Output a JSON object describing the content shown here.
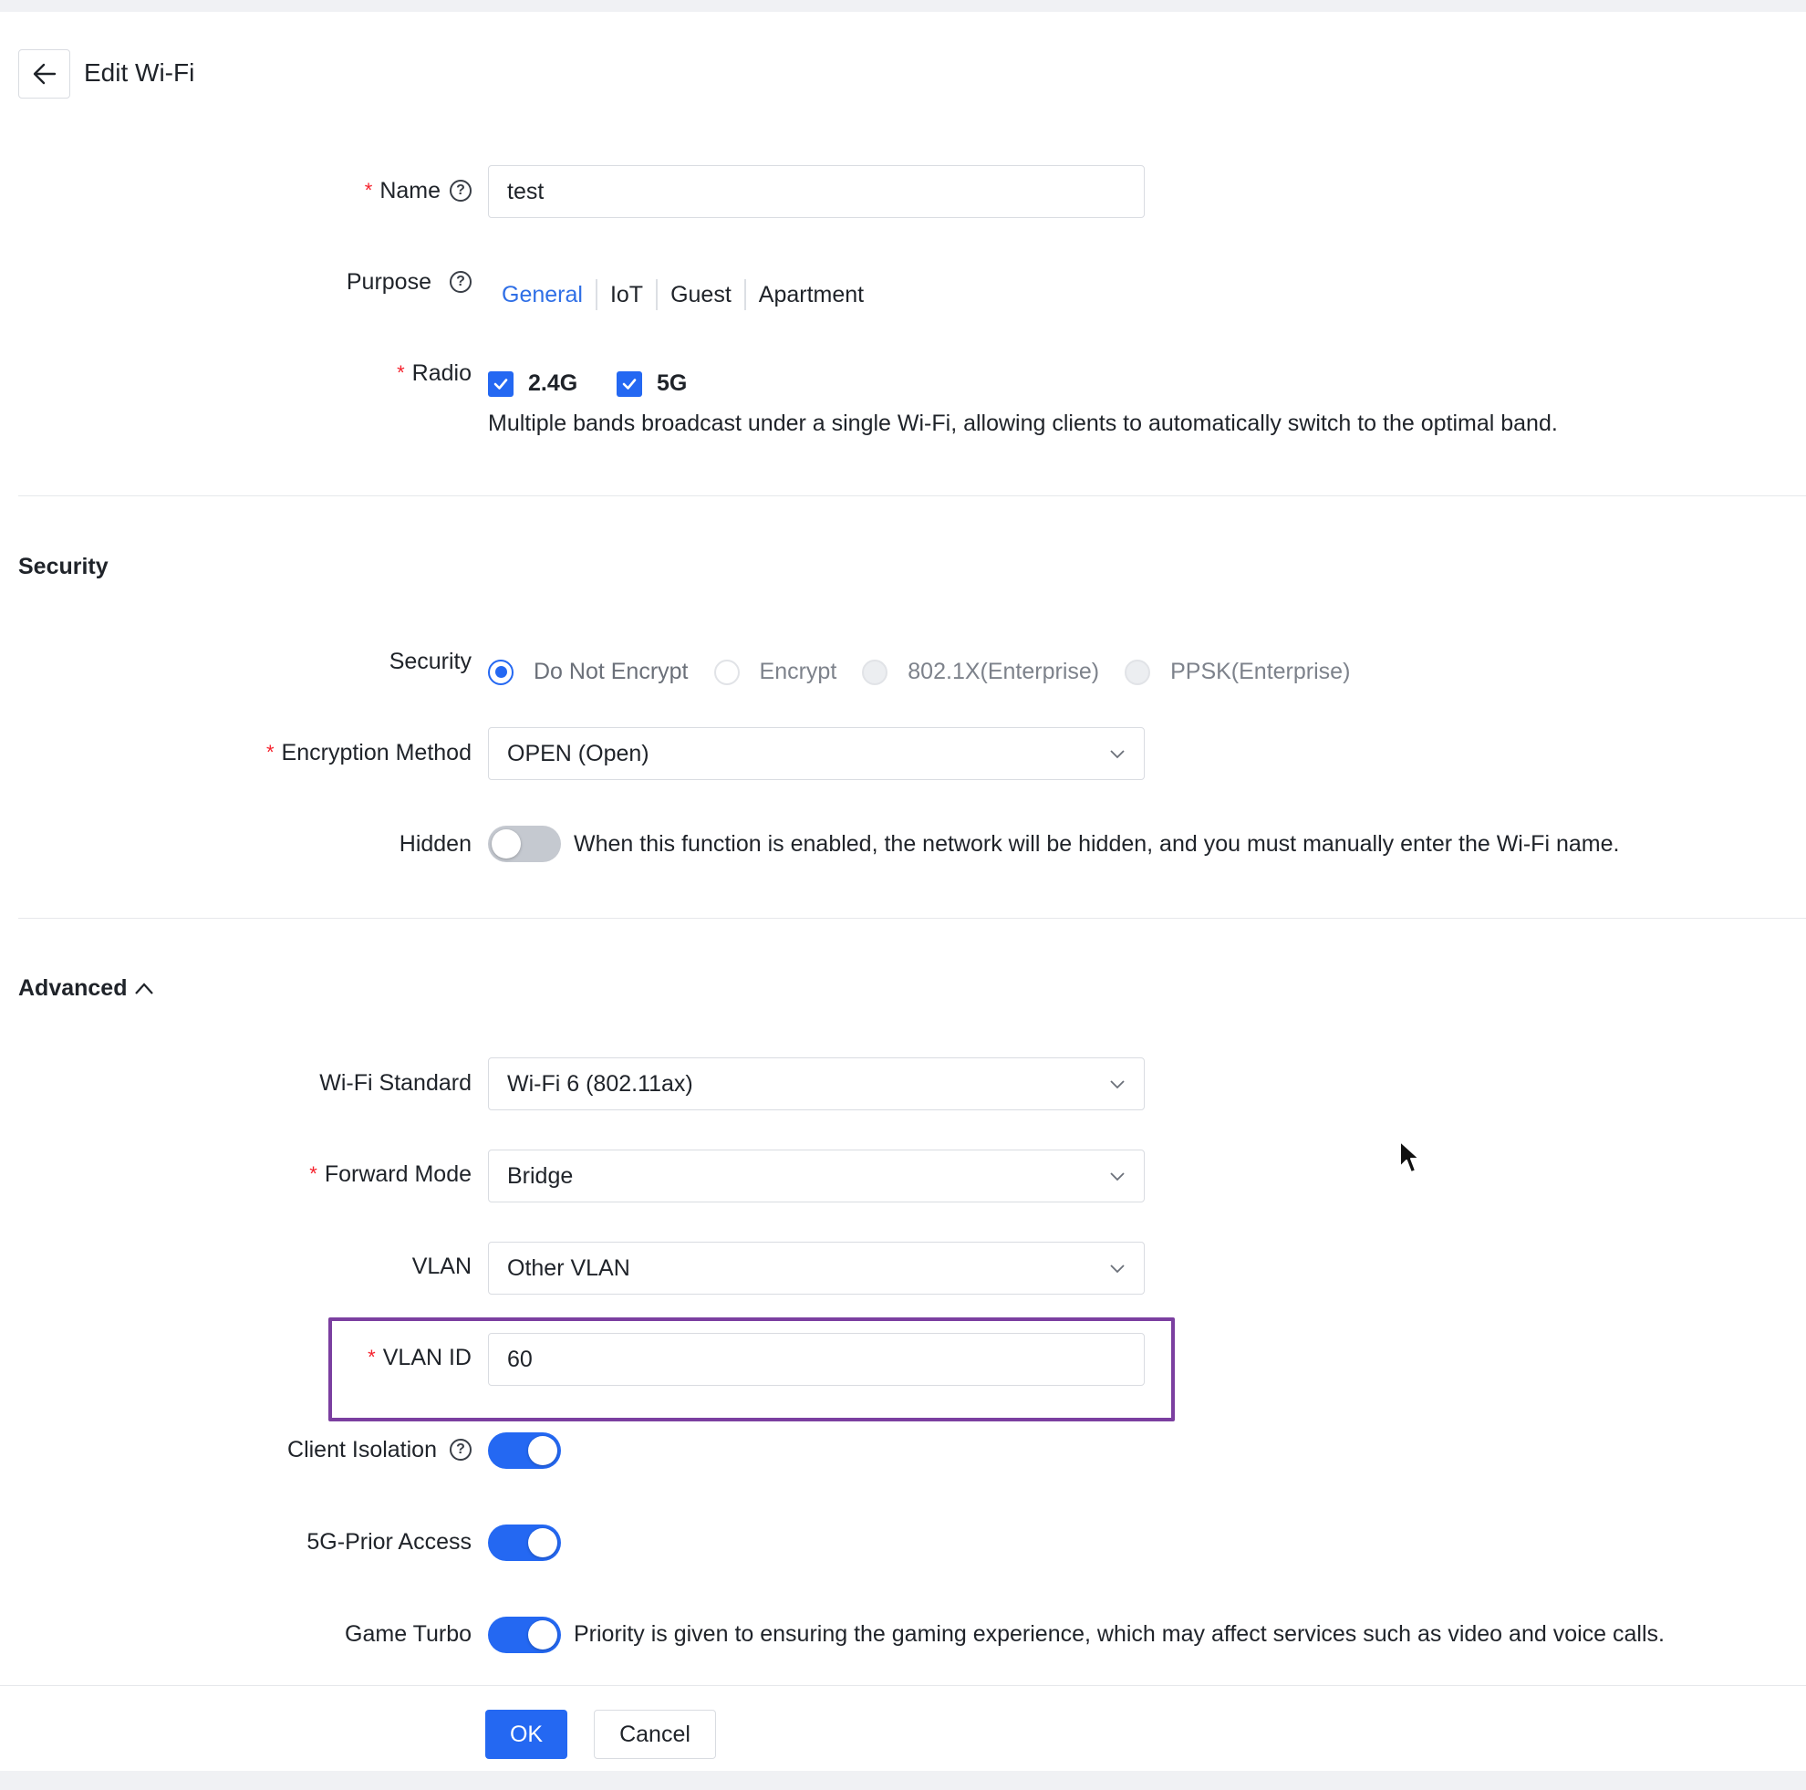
{
  "header": {
    "title": "Edit Wi-Fi"
  },
  "form": {
    "name": {
      "label": "Name",
      "value": "test"
    },
    "purpose": {
      "label": "Purpose",
      "options": [
        "General",
        "IoT",
        "Guest",
        "Apartment"
      ],
      "selected": "General"
    },
    "radio": {
      "label": "Radio",
      "options": [
        "2.4G",
        "5G"
      ],
      "hint": "Multiple bands broadcast under a single Wi-Fi, allowing clients to automatically switch to the optimal band."
    }
  },
  "security_section": {
    "title": "Security",
    "security": {
      "label": "Security",
      "options": [
        "Do Not Encrypt",
        "Encrypt",
        "802.1X(Enterprise)",
        "PPSK(Enterprise)"
      ],
      "selected": "Do Not Encrypt"
    },
    "encryption_method": {
      "label": "Encryption Method",
      "value": "OPEN (Open)"
    },
    "hidden": {
      "label": "Hidden",
      "enabled": false,
      "hint": "When this function is enabled, the network will be hidden, and you must manually enter the Wi-Fi name."
    }
  },
  "advanced_section": {
    "title": "Advanced",
    "wifi_standard": {
      "label": "Wi-Fi Standard",
      "value": "Wi-Fi 6 (802.11ax)"
    },
    "forward_mode": {
      "label": "Forward Mode",
      "value": "Bridge"
    },
    "vlan": {
      "label": "VLAN",
      "value": "Other VLAN"
    },
    "vlan_id": {
      "label": "VLAN ID",
      "value": "60"
    },
    "client_isolation": {
      "label": "Client Isolation",
      "enabled": true
    },
    "prior_access_5g": {
      "label": "5G-Prior Access",
      "enabled": true
    },
    "game_turbo": {
      "label": "Game Turbo",
      "enabled": true,
      "hint": "Priority is given to ensuring the gaming experience, which may affect services such as video and voice calls."
    }
  },
  "footer": {
    "ok_label": "OK",
    "cancel_label": "Cancel"
  },
  "colors": {
    "accent": "#2468f2",
    "highlight": "#7b3fa0",
    "required": "#f5222d"
  }
}
